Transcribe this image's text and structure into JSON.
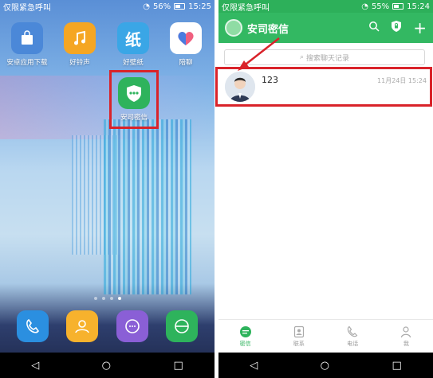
{
  "left_phone": {
    "status": {
      "carrier": "仅限紧急呼叫",
      "battery": "56%",
      "time": "15:25"
    },
    "apps": [
      {
        "label": "安卓应用下载",
        "icon": "shopping-bag-icon",
        "color": "#4b88d8"
      },
      {
        "label": "好铃声",
        "icon": "music-note-icon",
        "color": "#f5a623"
      },
      {
        "label": "好壁纸",
        "icon": "wallpaper-icon",
        "color": "#3aa6e6",
        "glyph": "纸"
      },
      {
        "label": "陪聊",
        "icon": "heart-icon",
        "color": "#ffffff"
      },
      {
        "label": "安司密信",
        "icon": "chat-shield-icon",
        "color": "#2eb35c"
      }
    ],
    "dock": [
      {
        "icon": "phone-icon",
        "color": "#2b8fe0"
      },
      {
        "icon": "contacts-icon",
        "color": "#f7b22d"
      },
      {
        "icon": "messages-icon",
        "color": "#8a5fd6"
      },
      {
        "icon": "browser-icon",
        "color": "#2eb35c"
      }
    ]
  },
  "right_phone": {
    "status": {
      "carrier": "仅限紧急呼叫",
      "battery": "55%",
      "time": "15:24"
    },
    "app_title": "安司密信",
    "search_placeholder": "搜索聊天记录",
    "chat": {
      "name": "123",
      "time": "11月24日 15:24"
    },
    "tabs": [
      {
        "label": "密信",
        "icon": "chat-icon",
        "active": true
      },
      {
        "label": "联系",
        "icon": "contacts-icon",
        "active": false
      },
      {
        "label": "电话",
        "icon": "phone-icon",
        "active": false
      },
      {
        "label": "我",
        "icon": "person-icon",
        "active": false
      }
    ]
  },
  "colors": {
    "brand_green": "#33b862",
    "highlight_red": "#d9232a"
  }
}
